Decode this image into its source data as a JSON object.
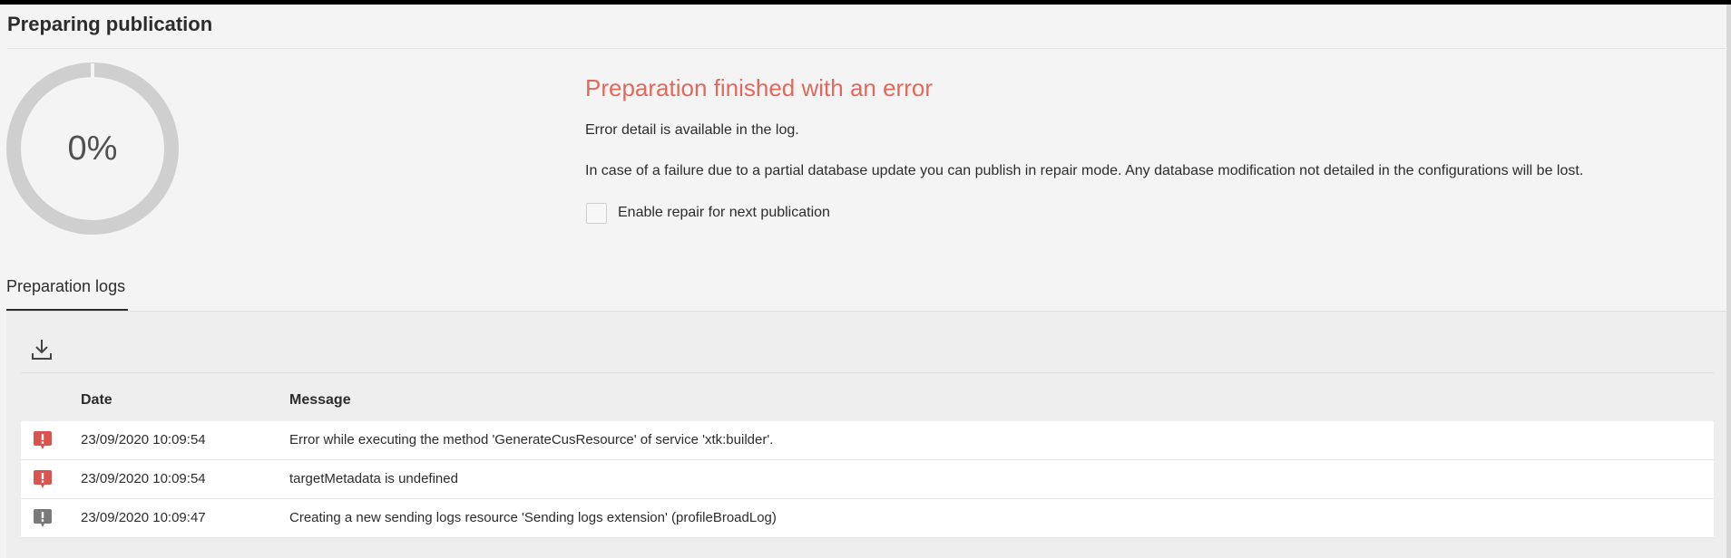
{
  "page": {
    "title": "Preparing publication"
  },
  "progress": {
    "percent": 0,
    "label": "0%"
  },
  "status": {
    "title": "Preparation finished with an error",
    "detail": "Error detail is available in the log.",
    "repair_note": "In case of a failure due to a partial database update you can publish in repair mode. Any database modification not detailed in the configurations will be lost.",
    "repair_checkbox_label": "Enable repair for next publication",
    "repair_checked": false
  },
  "logs": {
    "tab_label": "Preparation logs",
    "columns": {
      "date": "Date",
      "message": "Message"
    },
    "rows": [
      {
        "level": "error",
        "date": "23/09/2020 10:09:54",
        "message": "Error while executing the method 'GenerateCusResource' of service 'xtk:builder'."
      },
      {
        "level": "error",
        "date": "23/09/2020 10:09:54",
        "message": "targetMetadata is undefined"
      },
      {
        "level": "info",
        "date": "23/09/2020 10:09:47",
        "message": "Creating a new sending logs resource 'Sending logs extension' (profileBroadLog)"
      }
    ]
  },
  "colors": {
    "error": "#e0695b",
    "error_icon": "#d9534f",
    "info_icon": "#7a7a7a",
    "ring_track": "#cfcfcf"
  },
  "icons": {
    "download": "download-icon",
    "error": "error-alert-icon",
    "info": "info-alert-icon"
  }
}
